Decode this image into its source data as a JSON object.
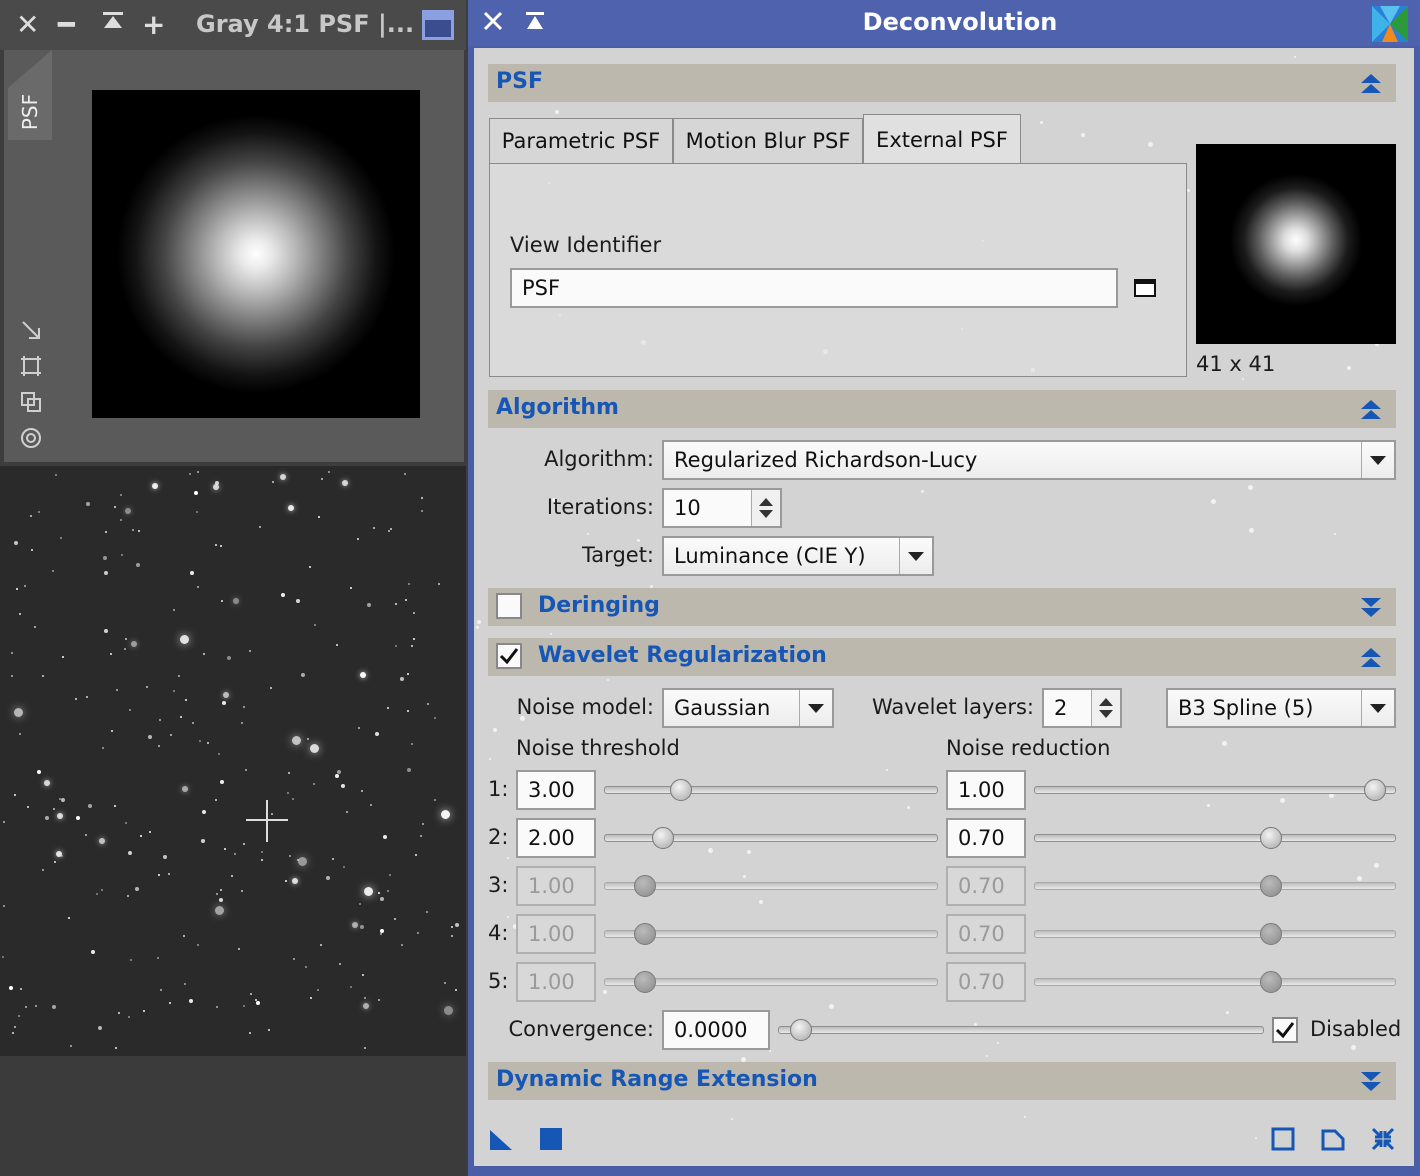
{
  "psf_window": {
    "title": "Gray 4:1 PSF |...",
    "side_tab": "PSF"
  },
  "dialog": {
    "title": "Deconvolution",
    "psf": {
      "section_title": "PSF",
      "tabs": [
        "Parametric PSF",
        "Motion Blur PSF",
        "External PSF"
      ],
      "active_tab": "External PSF",
      "view_identifier_label": "View Identifier",
      "view_identifier_value": "PSF",
      "preview_size": "41 x 41"
    },
    "algorithm": {
      "section_title": "Algorithm",
      "algorithm_label": "Algorithm:",
      "algorithm_value": "Regularized Richardson-Lucy",
      "iterations_label": "Iterations:",
      "iterations_value": "10",
      "target_label": "Target:",
      "target_value": "Luminance (CIE Y)"
    },
    "deringing": {
      "section_title": "Deringing",
      "checked": false
    },
    "wavelet": {
      "section_title": "Wavelet Regularization",
      "checked": true,
      "noise_model_label": "Noise model:",
      "noise_model_value": "Gaussian",
      "wavelet_layers_label": "Wavelet layers:",
      "wavelet_layers_value": "2",
      "scaling_function_value": "B3 Spline (5)",
      "noise_threshold_header": "Noise threshold",
      "noise_reduction_header": "Noise reduction",
      "layers": [
        {
          "label": "1:",
          "threshold": "3.00",
          "reduction": "1.00",
          "enabled": true
        },
        {
          "label": "2:",
          "threshold": "2.00",
          "reduction": "0.70",
          "enabled": true
        },
        {
          "label": "3:",
          "threshold": "1.00",
          "reduction": "0.70",
          "enabled": false
        },
        {
          "label": "4:",
          "threshold": "1.00",
          "reduction": "0.70",
          "enabled": false
        },
        {
          "label": "5:",
          "threshold": "1.00",
          "reduction": "0.70",
          "enabled": false
        }
      ],
      "convergence_label": "Convergence:",
      "convergence_value": "0.0000",
      "disabled_label": "Disabled",
      "disabled_checked": true
    },
    "dynamic_range": {
      "section_title": "Dynamic Range Extension"
    }
  },
  "colors": {
    "dialog_frame": "#4a5ea8",
    "section_title": "#1656b4",
    "section_bar": "#bcb8ae"
  }
}
